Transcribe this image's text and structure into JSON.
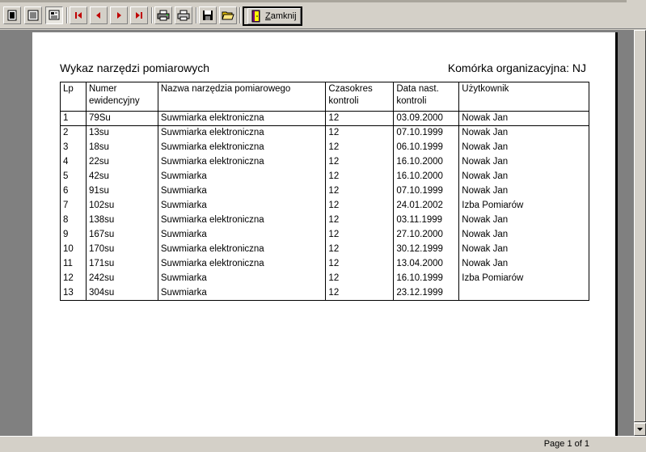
{
  "toolbar": {
    "buttons": [
      {
        "name": "one-page-view-button",
        "icon": "single-page-icon"
      },
      {
        "name": "multi-page-view-button",
        "icon": "multi-page-icon"
      },
      {
        "name": "zoom-view-button",
        "icon": "zoom-icon"
      },
      {
        "name": "first-page-button",
        "icon": "first-page-icon"
      },
      {
        "name": "prev-page-button",
        "icon": "prev-page-icon"
      },
      {
        "name": "next-page-button",
        "icon": "next-page-icon"
      },
      {
        "name": "last-page-button",
        "icon": "last-page-icon"
      },
      {
        "name": "print-setup-button",
        "icon": "printer-setup-icon"
      },
      {
        "name": "print-button",
        "icon": "printer-icon"
      },
      {
        "name": "save-button",
        "icon": "floppy-disk-icon"
      },
      {
        "name": "open-button",
        "icon": "folder-open-icon"
      }
    ],
    "close_label_prefix": "Z",
    "close_label_rest": "amknij"
  },
  "report": {
    "title": "Wykaz narzędzi pomiarowych",
    "org_unit": "Komórka organizacyjna: NJ",
    "columns": [
      {
        "line1": "Lp",
        "line2": ""
      },
      {
        "line1": "Numer",
        "line2": "ewidencyjny"
      },
      {
        "line1": "Nazwa narzędzia pomiarowego",
        "line2": ""
      },
      {
        "line1": "Czasokres",
        "line2": "kontroli"
      },
      {
        "line1": "Data nast.",
        "line2": "kontroli"
      },
      {
        "line1": "Użytkownik",
        "line2": ""
      }
    ],
    "rows": [
      [
        "1",
        "79Su",
        "Suwmiarka elektroniczna",
        "12",
        "03.09.2000",
        "Nowak Jan"
      ],
      [
        "2",
        "13su",
        "Suwmiarka elektroniczna",
        "12",
        "07.10.1999",
        "Nowak Jan"
      ],
      [
        "3",
        "18su",
        "Suwmiarka elektroniczna",
        "12",
        "06.10.1999",
        "Nowak Jan"
      ],
      [
        "4",
        "22su",
        "Suwmiarka elektroniczna",
        "12",
        "16.10.2000",
        "Nowak Jan"
      ],
      [
        "5",
        "42su",
        "Suwmiarka",
        "12",
        "16.10.2000",
        "Nowak Jan"
      ],
      [
        "6",
        "91su",
        "Suwmiarka",
        "12",
        "07.10.1999",
        "Nowak Jan"
      ],
      [
        "7",
        "102su",
        "Suwmiarka",
        "12",
        "24.01.2002",
        "Izba Pomiarów"
      ],
      [
        "8",
        "138su",
        "Suwmiarka elektroniczna",
        "12",
        "03.11.1999",
        "Nowak Jan"
      ],
      [
        "9",
        "167su",
        "Suwmiarka",
        "12",
        "27.10.2000",
        "Nowak Jan"
      ],
      [
        "10",
        "170su",
        "Suwmiarka elektroniczna",
        "12",
        "30.12.1999",
        "Nowak Jan"
      ],
      [
        "11",
        "171su",
        "Suwmiarka elektroniczna",
        "12",
        "13.04.2000",
        "Nowak Jan"
      ],
      [
        "12",
        "242su",
        "Suwmiarka",
        "12",
        "16.10.1999",
        "Izba Pomiarów"
      ],
      [
        "13",
        "304su",
        "Suwmiarka",
        "12",
        "23.12.1999",
        ""
      ]
    ]
  },
  "status": {
    "page_info": "Page 1 of 1"
  }
}
